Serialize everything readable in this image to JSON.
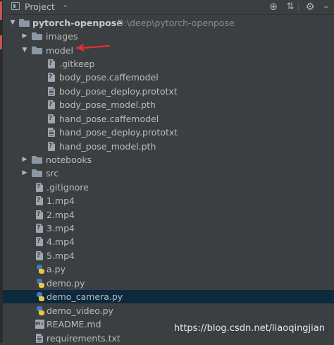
{
  "header": {
    "title": "Project",
    "icons": [
      "project-view-icon",
      "chevron-down-icon",
      "crosshair-icon",
      "collapse-all-icon",
      "expand-all-icon",
      "gear-icon",
      "minimize-icon"
    ]
  },
  "tree": {
    "root": {
      "name": "pytorch-openpose",
      "path": "D:\\deep\\pytorch-openpose"
    },
    "items": [
      {
        "label": "images",
        "type": "folder",
        "expanded": false
      },
      {
        "label": "model",
        "type": "folder",
        "expanded": true
      },
      {
        "label": ".gitkeep",
        "type": "file-unknown"
      },
      {
        "label": "body_pose.caffemodel",
        "type": "file-unknown"
      },
      {
        "label": "body_pose_deploy.prototxt",
        "type": "file-text"
      },
      {
        "label": "body_pose_model.pth",
        "type": "file-unknown"
      },
      {
        "label": "hand_pose.caffemodel",
        "type": "file-unknown"
      },
      {
        "label": "hand_pose_deploy.prototxt",
        "type": "file-text"
      },
      {
        "label": "hand_pose_model.pth",
        "type": "file-unknown"
      },
      {
        "label": "notebooks",
        "type": "folder",
        "expanded": false
      },
      {
        "label": "src",
        "type": "folder",
        "expanded": false
      },
      {
        "label": ".gitignore",
        "type": "file-unknown"
      },
      {
        "label": "1.mp4",
        "type": "file-unknown"
      },
      {
        "label": "2.mp4",
        "type": "file-unknown"
      },
      {
        "label": "3.mp4",
        "type": "file-unknown"
      },
      {
        "label": "4.mp4",
        "type": "file-unknown"
      },
      {
        "label": "5.mp4",
        "type": "file-unknown"
      },
      {
        "label": "a.py",
        "type": "python"
      },
      {
        "label": "demo.py",
        "type": "python"
      },
      {
        "label": "demo_camera.py",
        "type": "python",
        "selected": true
      },
      {
        "label": "demo_video.py",
        "type": "python"
      },
      {
        "label": "README.md",
        "type": "markdown"
      },
      {
        "label": "requirements.txt",
        "type": "file-text"
      }
    ]
  },
  "annotation": {
    "color": "#e03030"
  },
  "watermark": "https://blog.csdn.net/liaoqingjian",
  "colors": {
    "background": "#3c3f41",
    "selection": "#0d293e",
    "text": "#bbbbbb"
  }
}
